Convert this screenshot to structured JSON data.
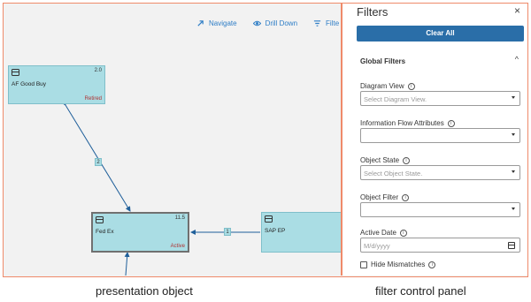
{
  "toolbar": {
    "navigate": "Navigate",
    "drill_down": "Drill Down",
    "filter": "Filte"
  },
  "nodes": {
    "af_good_buy": {
      "name": "AF Good Buy",
      "version": "2.0",
      "status": "Retired"
    },
    "fed_ex": {
      "name": "Fed Ex",
      "version": "11.5",
      "status": "Active"
    },
    "sap_ep": {
      "name": "SAP EP"
    }
  },
  "edges": {
    "af_to_fedex": "2",
    "sap_to_fedex": "1"
  },
  "panel": {
    "title": "Filters",
    "close": "×",
    "clear_all": "Clear All",
    "global_filters": "Global Filters",
    "chevron": "^",
    "diagram_view": {
      "label": "Diagram View",
      "placeholder": "Select Diagram View."
    },
    "info_flow": {
      "label": "Information Flow Attributes",
      "placeholder": ""
    },
    "object_state": {
      "label": "Object State",
      "placeholder": "Select Object State."
    },
    "object_filter": {
      "label": "Object Filter",
      "placeholder": ""
    },
    "active_date": {
      "label": "Active Date",
      "placeholder": "M/d/yyyy"
    },
    "hide_mismatches": "Hide Mismatches",
    "info_glyph": "i"
  },
  "captions": {
    "left": "presentation object",
    "right": "filter control panel"
  },
  "colors": {
    "node_fill": "#aadde4",
    "accent": "#2a6ea8",
    "link": "#2d7dc6",
    "highlight_border": "#ef8a6a",
    "retired": "#b03030"
  }
}
